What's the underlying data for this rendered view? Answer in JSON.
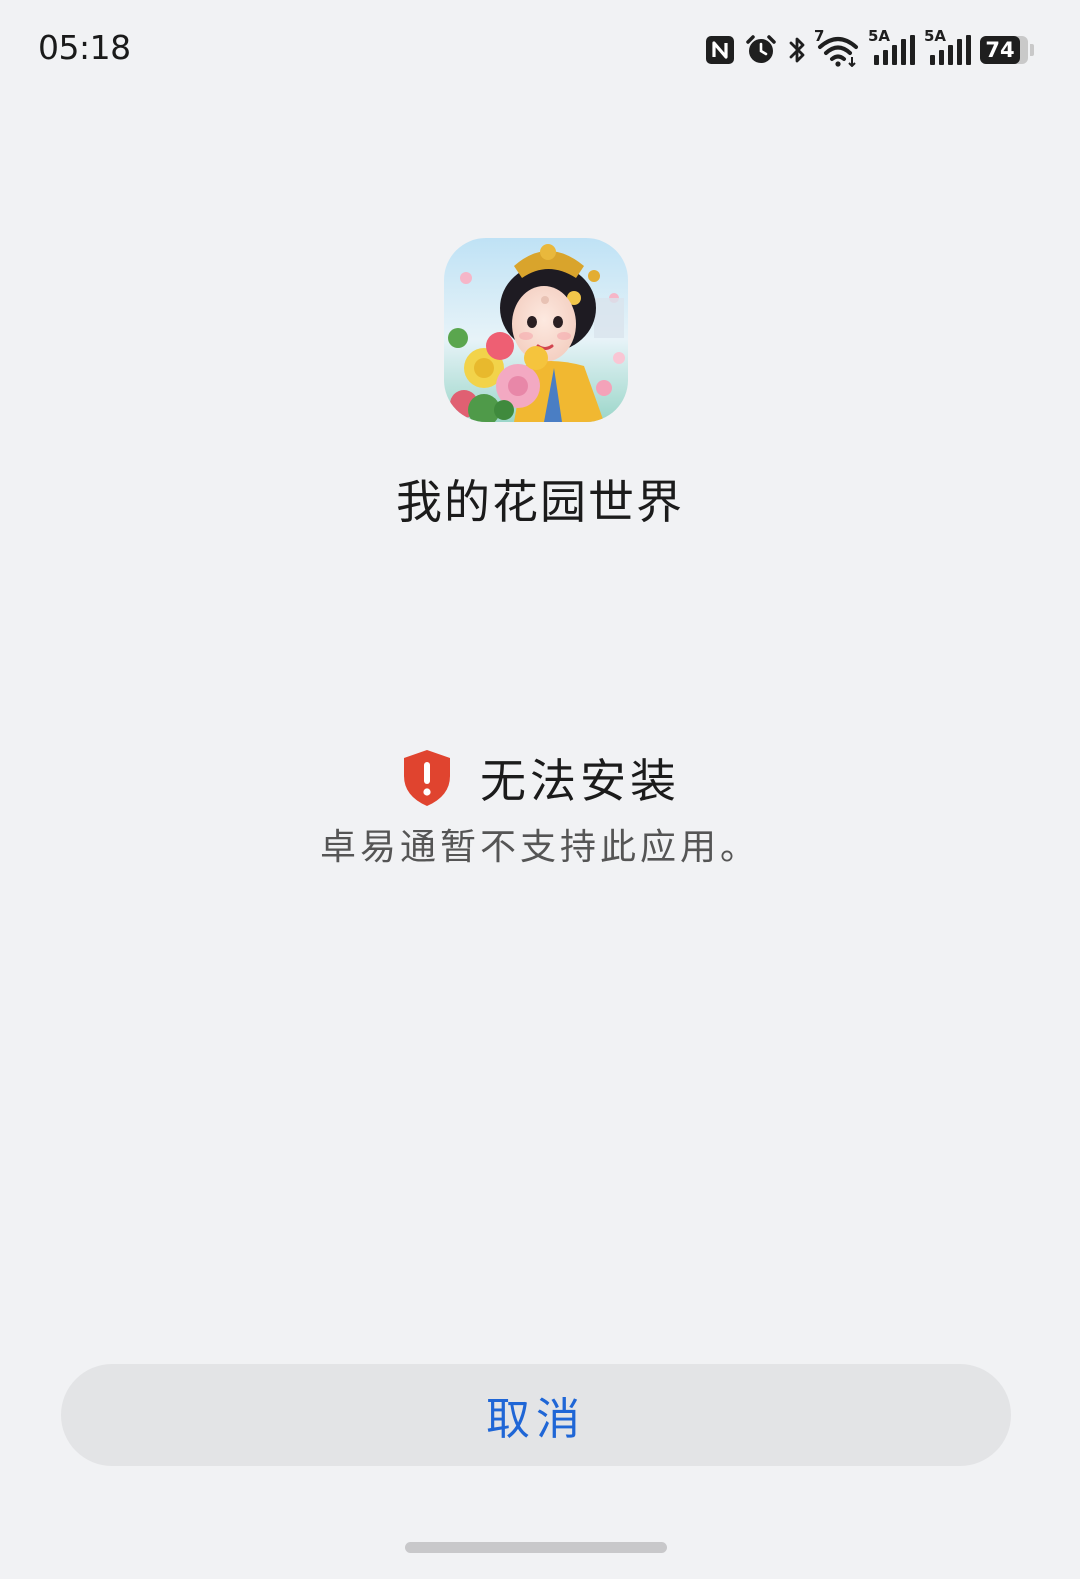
{
  "status_bar": {
    "time": "05:18",
    "icons": [
      "nfc-icon",
      "alarm-icon",
      "bluetooth-icon",
      "wifi-icon",
      "signal-5a-icon",
      "signal-5a-icon"
    ],
    "wifi_badge": "7",
    "signal1_badge": "5A",
    "signal2_badge": "5A",
    "battery_level": "74"
  },
  "app": {
    "name": "我的花园世界",
    "icon": "app-icon-garden-lady"
  },
  "error": {
    "icon": "shield-warning-icon",
    "title": "无法安装",
    "description": "卓易通暂不支持此应用。"
  },
  "actions": {
    "cancel_label": "取消"
  },
  "colors": {
    "background": "#f1f2f4",
    "accent": "#1f66d6",
    "error_red": "#e0442f",
    "button_bg": "#e3e4e6"
  }
}
